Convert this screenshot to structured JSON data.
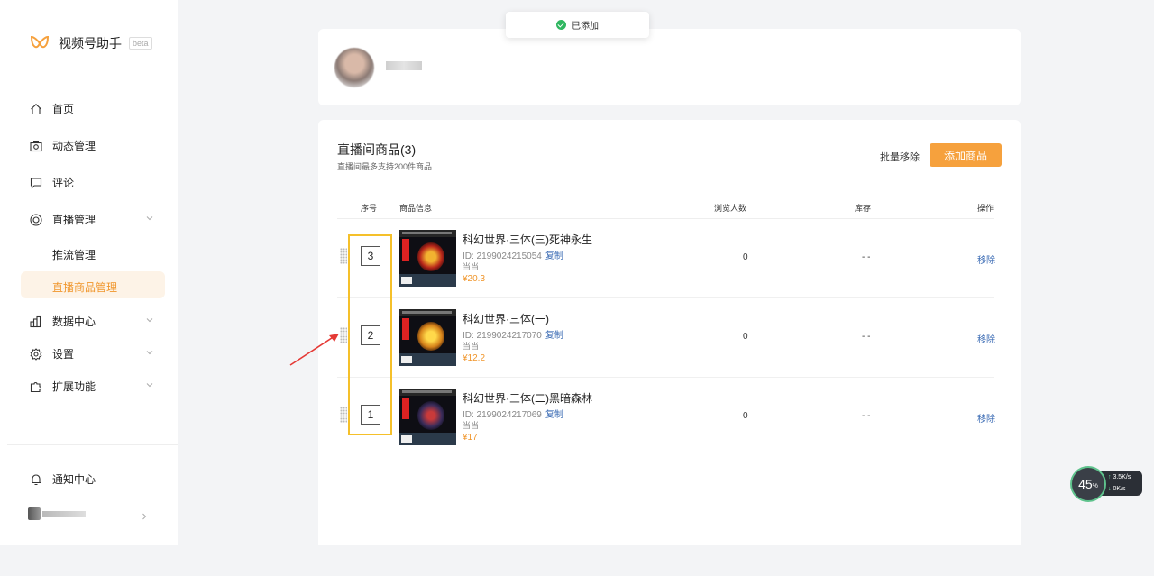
{
  "sidebar": {
    "brand": "视频号助手",
    "beta": "beta",
    "items": [
      {
        "label": "首页"
      },
      {
        "label": "动态管理"
      },
      {
        "label": "评论"
      },
      {
        "label": "直播管理"
      },
      {
        "label": "数据中心"
      },
      {
        "label": "设置"
      },
      {
        "label": "扩展功能"
      }
    ],
    "subitems": [
      {
        "label": "推流管理"
      },
      {
        "label": "直播商品管理"
      }
    ],
    "notify": "通知中心"
  },
  "toast": {
    "text": "已添加"
  },
  "section": {
    "title": "直播间商品(3)",
    "subtitle": "直播间最多支持200件商品",
    "batch_remove": "批量移除",
    "add_button": "添加商品"
  },
  "table": {
    "headers": {
      "seq": "序号",
      "info": "商品信息",
      "views": "浏览人数",
      "stock": "库存",
      "op": "操作"
    },
    "rows": [
      {
        "seq": "3",
        "name": "科幻世界·三体(三)死神永生",
        "id": "ID: 2199024215054",
        "copy": "复制",
        "shop": "当当",
        "price": "¥20.3",
        "views": "0",
        "stock": "- -",
        "action": "移除"
      },
      {
        "seq": "2",
        "name": "科幻世界·三体(一)",
        "id": "ID: 2199024217070",
        "copy": "复制",
        "shop": "当当",
        "price": "¥12.2",
        "views": "0",
        "stock": "- -",
        "action": "移除"
      },
      {
        "seq": "1",
        "name": "科幻世界·三体(二)黑暗森林",
        "id": "ID: 2199024217069",
        "copy": "复制",
        "shop": "当当",
        "price": "¥17",
        "views": "0",
        "stock": "- -",
        "action": "移除"
      }
    ]
  },
  "monitor": {
    "percent": "45",
    "unit": "%",
    "up": "3.5",
    "down": "0",
    "speed_unit": "K/s"
  },
  "colors": {
    "accent": "#f6a13d",
    "link": "#3d6db5",
    "highlight": "#f5c02a",
    "arrow": "#e53935"
  }
}
